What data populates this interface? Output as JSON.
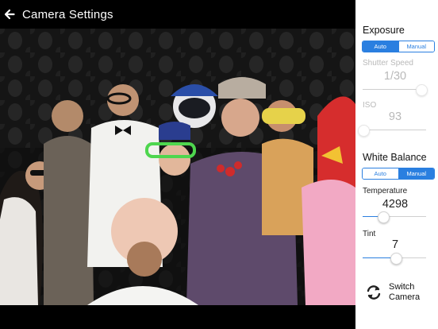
{
  "header": {
    "title": "Camera Settings"
  },
  "exposure": {
    "title": "Exposure",
    "modes": [
      "Auto",
      "Manual"
    ],
    "selected_mode": "Auto",
    "shutter_speed": {
      "label": "Shutter Speed",
      "value": "1/30",
      "level": 0.92
    },
    "iso": {
      "label": "ISO",
      "value": "93",
      "level": 0.0
    }
  },
  "white_balance": {
    "title": "White Balance",
    "modes": [
      "Auto",
      "Manual"
    ],
    "selected_mode": "Manual",
    "temperature": {
      "label": "Temperature",
      "value": "4298",
      "level": 0.32
    },
    "tint": {
      "label": "Tint",
      "value": "7",
      "level": 0.52
    }
  },
  "switch_camera": {
    "line1": "Switch",
    "line2": "Camera"
  },
  "colors": {
    "accent": "#2a7fe0",
    "panel_bg": "#ffffff",
    "bar_bg": "#000000",
    "disabled_text": "#b9b9b9"
  },
  "icons": {
    "back": "arrow-left-icon",
    "switch": "refresh-arrows-icon"
  }
}
